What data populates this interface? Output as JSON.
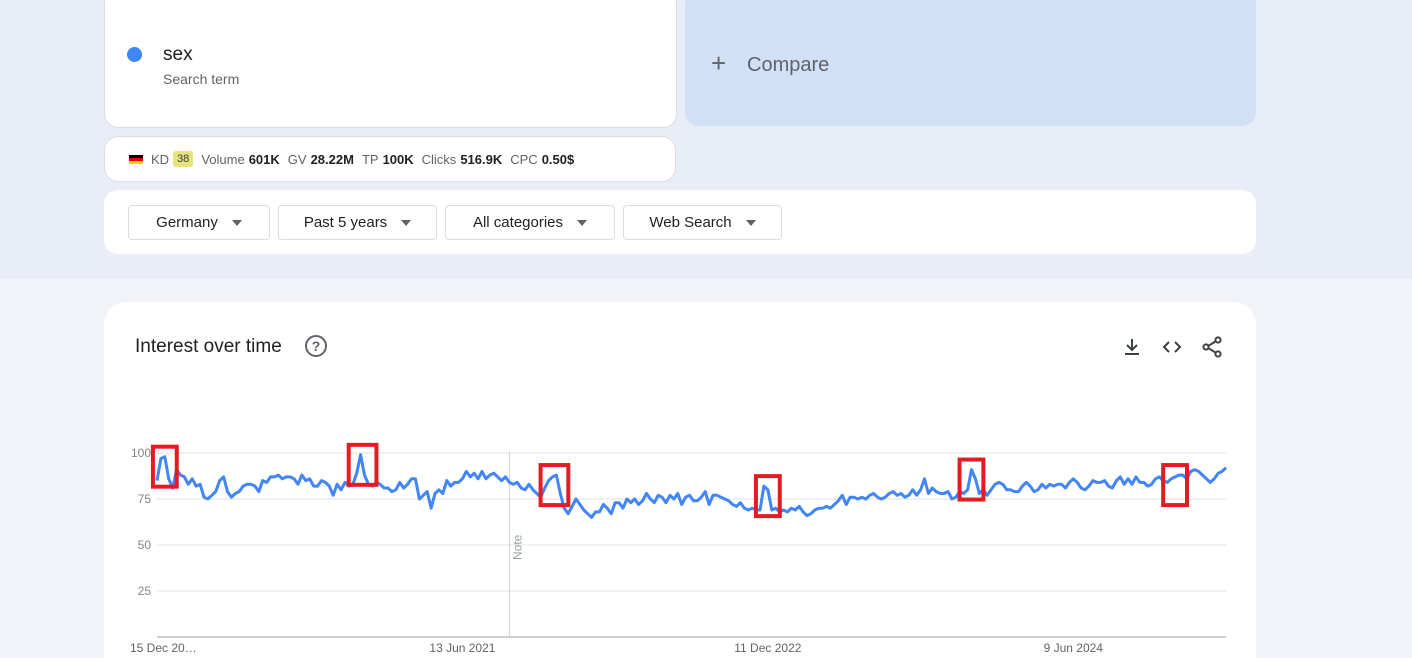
{
  "term": {
    "name": "sex",
    "subtitle": "Search term",
    "dot_color": "#4285f4"
  },
  "compare": {
    "plus": "+",
    "label": "Compare"
  },
  "metrics": {
    "kd_label": "KD",
    "kd_value": "38",
    "volume_label": "Volume",
    "volume_value": "601K",
    "gv_label": "GV",
    "gv_value": "28.22M",
    "tp_label": "TP",
    "tp_value": "100K",
    "clicks_label": "Clicks",
    "clicks_value": "516.9K",
    "cpc_label": "CPC",
    "cpc_value": "0.50$"
  },
  "filters": {
    "region": "Germany",
    "time": "Past 5 years",
    "category": "All categories",
    "search_type": "Web Search"
  },
  "chart": {
    "title": "Interest over time",
    "help_icon": "help-circle-icon",
    "icons": [
      "download-icon",
      "embed-code-icon",
      "share-icon"
    ],
    "note_label": "Note"
  },
  "chart_data": {
    "type": "line",
    "series": [
      {
        "color": "#4285f4",
        "values": [
          85,
          97,
          98,
          86,
          81,
          91,
          88,
          87,
          83,
          86,
          82,
          83,
          76,
          75,
          77,
          79,
          85,
          87,
          79,
          76,
          78,
          79,
          82,
          83,
          83,
          82,
          79,
          85,
          84,
          87,
          87,
          88,
          86,
          87,
          87,
          86,
          83,
          88,
          85,
          86,
          82,
          82,
          85,
          84,
          82,
          77,
          83,
          80,
          84,
          82,
          83,
          89,
          99,
          88,
          83,
          82,
          84,
          83,
          81,
          81,
          79,
          80,
          84,
          81,
          83,
          86,
          86,
          75,
          77,
          79,
          70,
          78,
          80,
          78,
          85,
          82,
          84,
          84,
          86,
          90,
          87,
          89,
          86,
          90,
          86,
          88,
          89,
          87,
          85,
          87,
          84,
          83,
          84,
          81,
          80,
          83,
          80,
          78,
          76,
          81,
          85,
          87,
          88,
          78,
          70,
          67,
          71,
          75,
          72,
          69,
          67,
          65,
          68,
          68,
          72,
          70,
          67,
          73,
          73,
          70,
          75,
          73,
          75,
          72,
          74,
          78,
          75,
          73,
          77,
          76,
          73,
          77,
          75,
          78,
          72,
          76,
          77,
          74,
          74,
          76,
          79,
          72,
          77,
          77,
          76,
          75,
          74,
          72,
          71,
          73,
          70,
          69,
          70,
          69,
          69,
          82,
          80,
          69,
          70,
          68,
          69,
          68,
          70,
          69,
          71,
          68,
          66,
          67,
          69,
          70,
          70,
          71,
          70,
          72,
          74,
          77,
          72,
          76,
          76,
          75,
          76,
          75,
          77,
          78,
          76,
          75,
          76,
          78,
          79,
          77,
          78,
          76,
          77,
          80,
          77,
          80,
          86,
          78,
          81,
          79,
          78,
          78,
          79,
          75,
          76,
          79,
          78,
          80,
          91,
          86,
          78,
          80,
          77,
          80,
          83,
          84,
          83,
          80,
          80,
          79,
          79,
          82,
          84,
          82,
          79,
          80,
          83,
          81,
          83,
          82,
          83,
          83,
          81,
          84,
          86,
          84,
          81,
          80,
          82,
          85,
          84,
          84,
          85,
          82,
          81,
          85,
          87,
          83,
          86,
          83,
          87,
          84,
          84,
          82,
          83,
          86,
          87,
          85,
          84,
          86,
          87,
          88,
          88,
          86,
          90,
          91,
          90,
          88,
          86,
          84,
          86,
          89,
          90,
          92
        ]
      }
    ],
    "x_start": "15 Dec 2019",
    "x_tick_labels": [
      "15 Dec 20…",
      "13 Jun 2021",
      "11 Dec 2022",
      "9 Jun 2024"
    ],
    "y_tick_labels": [
      "100",
      "75",
      "50",
      "25"
    ],
    "ylim": [
      0,
      100
    ],
    "grid": true,
    "highlight_color": "#e31b23",
    "highlights": [
      {
        "from_index": 1,
        "to_index": 3
      },
      {
        "from_index": 51,
        "to_index": 54
      },
      {
        "from_index": 100,
        "to_index": 103
      },
      {
        "from_index": 155,
        "to_index": 157
      },
      {
        "from_index": 207,
        "to_index": 209
      },
      {
        "from_index": 259,
        "to_index": 261
      }
    ]
  }
}
